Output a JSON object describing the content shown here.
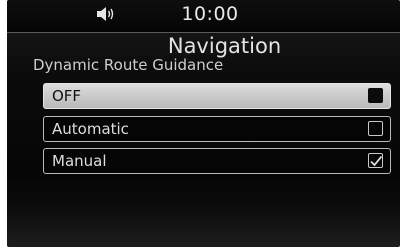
{
  "status_bar": {
    "volume_icon": "speaker-volume-icon",
    "time": "10:00"
  },
  "header": {
    "title": "Navigation",
    "subtitle": "Dynamic Route Guidance"
  },
  "options": [
    {
      "label": "OFF",
      "highlighted": true,
      "checked": false
    },
    {
      "label": "Automatic",
      "highlighted": false,
      "checked": false
    },
    {
      "label": "Manual",
      "highlighted": false,
      "checked": true
    }
  ],
  "colors": {
    "background": "#0b0b0b",
    "highlight": "#c8c8c8",
    "text": "#e3e3e3"
  }
}
